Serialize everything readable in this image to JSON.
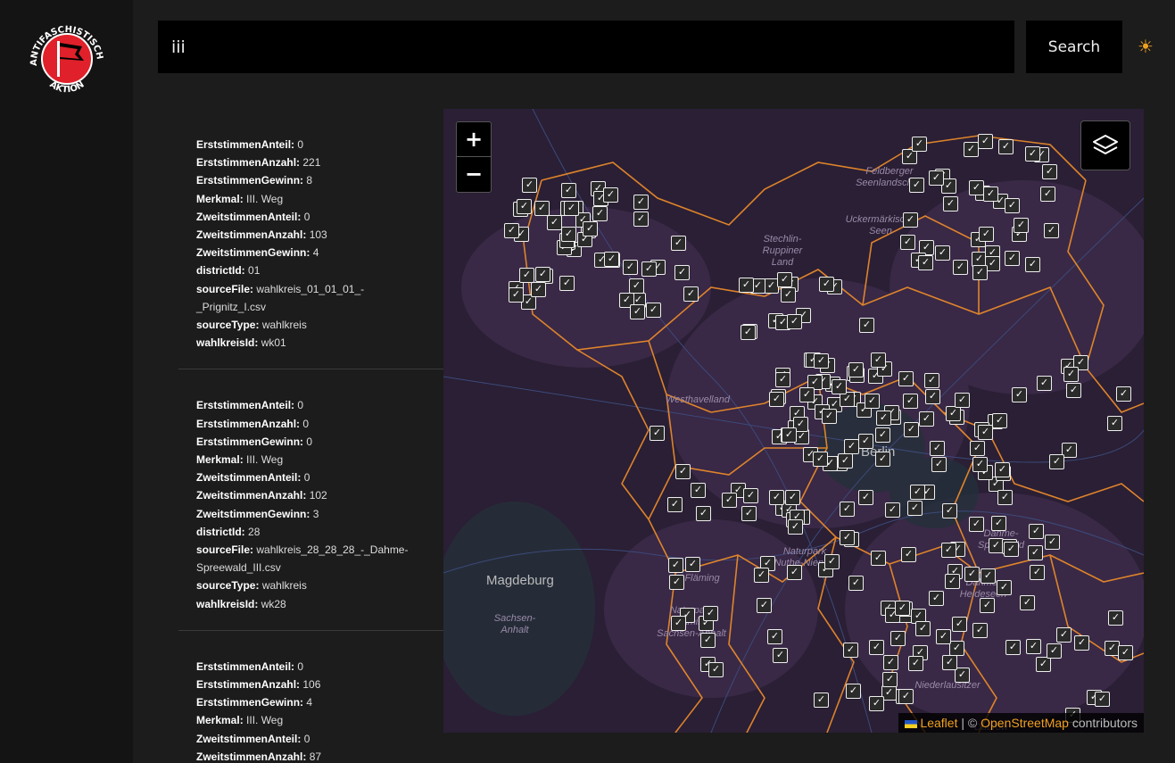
{
  "search": {
    "value": "iii",
    "button_label": "Search",
    "theme_icon": "☀"
  },
  "logo": {
    "text_top": "ANTIFASCHISTISCHE",
    "text_bottom": "AKTION"
  },
  "results": [
    {
      "fields": [
        {
          "k": "ErststimmenAnteil:",
          "v": "0"
        },
        {
          "k": "ErststimmenAnzahl:",
          "v": "221"
        },
        {
          "k": "ErststimmenGewinn:",
          "v": "8"
        },
        {
          "k": "Merkmal:",
          "v": "III. Weg"
        },
        {
          "k": "ZweitstimmenAnteil:",
          "v": "0"
        },
        {
          "k": "ZweitstimmenAnzahl:",
          "v": "103"
        },
        {
          "k": "ZweitstimmenGewinn:",
          "v": "4"
        },
        {
          "k": "districtId:",
          "v": "01"
        },
        {
          "k": "sourceFile:",
          "v": "wahlkreis_01_01_01_-_Prignitz_I.csv"
        },
        {
          "k": "sourceType:",
          "v": "wahlkreis"
        },
        {
          "k": "wahlkreisId:",
          "v": "wk01"
        }
      ]
    },
    {
      "fields": [
        {
          "k": "ErststimmenAnteil:",
          "v": "0"
        },
        {
          "k": "ErststimmenAnzahl:",
          "v": "0"
        },
        {
          "k": "ErststimmenGewinn:",
          "v": "0"
        },
        {
          "k": "Merkmal:",
          "v": "III. Weg"
        },
        {
          "k": "ZweitstimmenAnteil:",
          "v": "0"
        },
        {
          "k": "ZweitstimmenAnzahl:",
          "v": "102"
        },
        {
          "k": "ZweitstimmenGewinn:",
          "v": "3"
        },
        {
          "k": "districtId:",
          "v": "28"
        },
        {
          "k": "sourceFile:",
          "v": "wahlkreis_28_28_28_-_Dahme-Spreewald_III.csv"
        },
        {
          "k": "sourceType:",
          "v": "wahlkreis"
        },
        {
          "k": "wahlkreisId:",
          "v": "wk28"
        }
      ]
    },
    {
      "fields": [
        {
          "k": "ErststimmenAnteil:",
          "v": "0"
        },
        {
          "k": "ErststimmenAnzahl:",
          "v": "106"
        },
        {
          "k": "ErststimmenGewinn:",
          "v": "4"
        },
        {
          "k": "Merkmal:",
          "v": "III. Weg"
        },
        {
          "k": "ZweitstimmenAnteil:",
          "v": "0"
        },
        {
          "k": "ZweitstimmenAnzahl:",
          "v": "87"
        }
      ]
    }
  ],
  "map": {
    "zoom_in": "+",
    "zoom_out": "−",
    "labels": [
      {
        "text": "Feldberger Seenlandschaft",
        "kind": "region"
      },
      {
        "text": "Uckermärkische Seen",
        "kind": "region"
      },
      {
        "text": "Stechlin-Ruppiner Land",
        "kind": "region"
      },
      {
        "text": "Westhavelland",
        "kind": "region"
      },
      {
        "text": "Berlin",
        "kind": "city"
      },
      {
        "text": "Magdeburg",
        "kind": "city"
      },
      {
        "text": "Sachsen-Anhalt",
        "kind": "region"
      },
      {
        "text": "Naturpark Nuthe-Nieplitz",
        "kind": "region"
      },
      {
        "text": "Naturpark Fläming Sachsen-Anhalt",
        "kind": "region"
      },
      {
        "text": "Fläming",
        "kind": "region"
      },
      {
        "text": "Dahme-Heideseen",
        "kind": "region"
      },
      {
        "text": "Dahme-Spreewald",
        "kind": "region"
      },
      {
        "text": "Niederlausitzer",
        "kind": "region"
      },
      {
        "text": "Dubrow",
        "kind": "region"
      }
    ],
    "attribution": {
      "leaflet": "Leaflet",
      "separator": "| ©",
      "osm": "OpenStreetMap",
      "contributors": "contributors"
    },
    "colors": {
      "base": "#2a1f35",
      "boundary": "#e8892a",
      "accent": "#f0a020"
    },
    "marker_icon": "checkbox-icon"
  }
}
